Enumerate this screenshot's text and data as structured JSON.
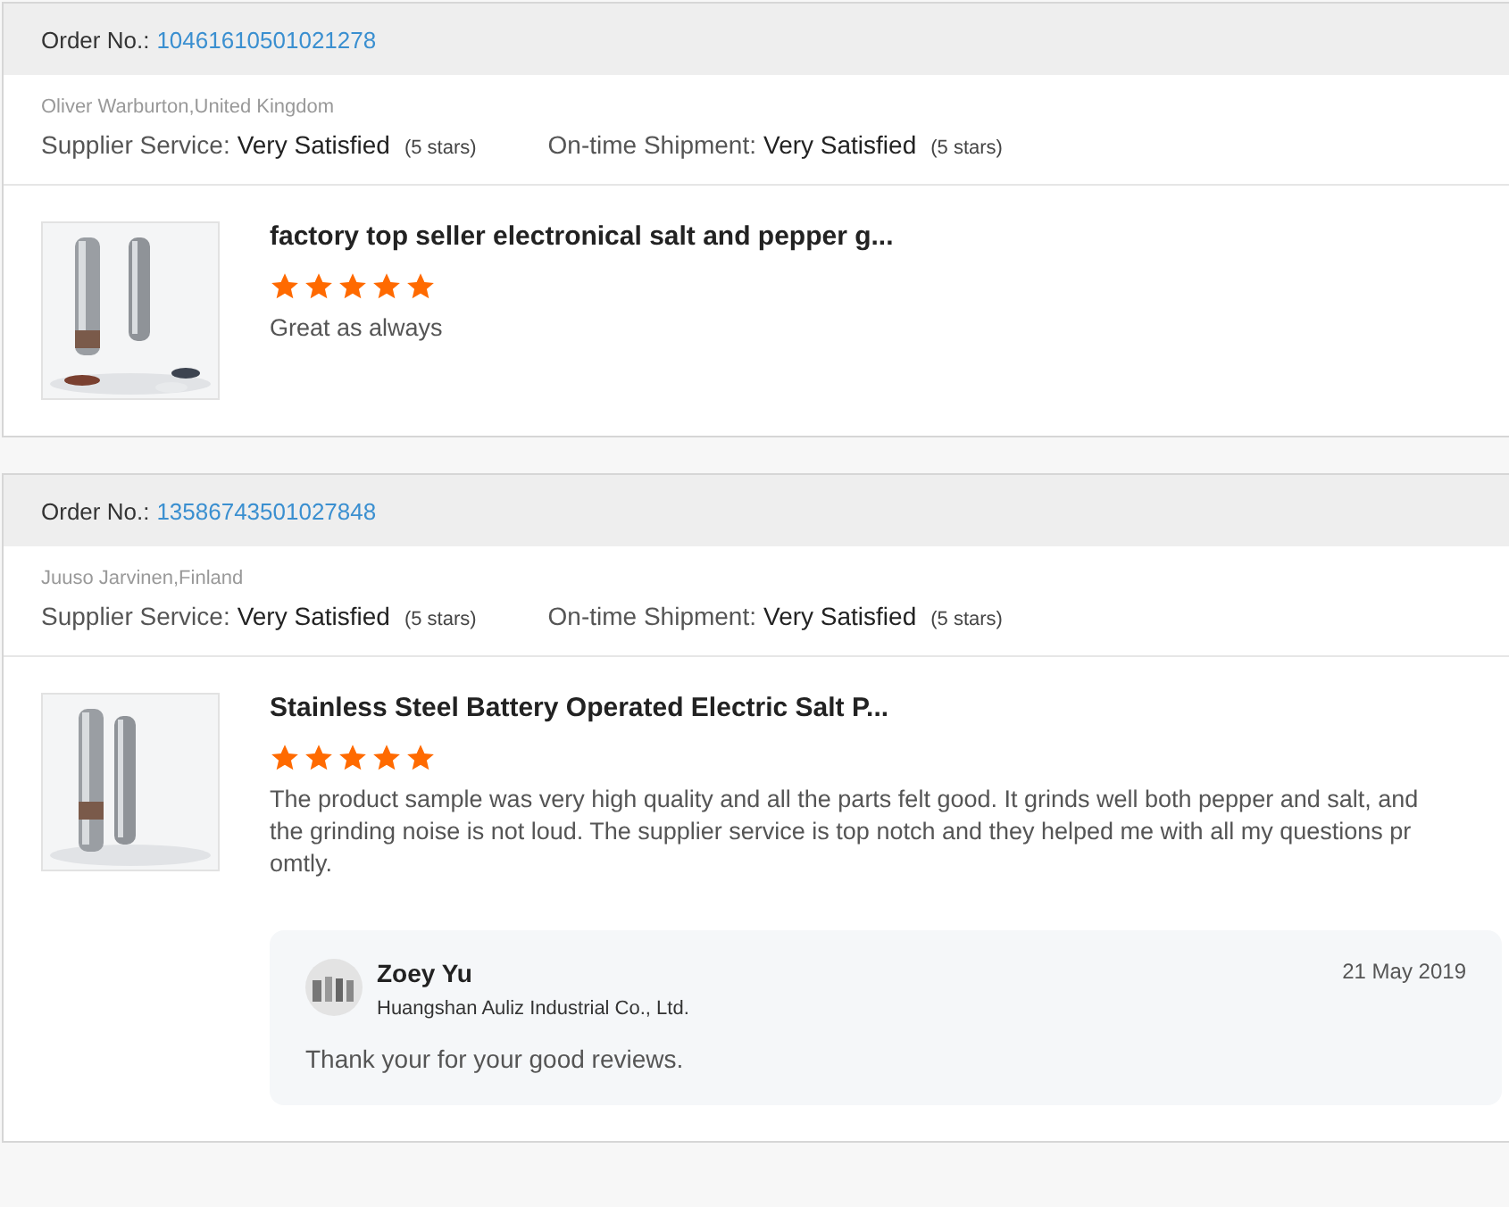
{
  "reviews": [
    {
      "order_label": "Order No.:",
      "order_number": "10461610501021278",
      "buyer": "Oliver Warburton,United Kingdom",
      "ratings": [
        {
          "label": "Supplier Service:",
          "value": "Very Satisfied",
          "note": "(5 stars)"
        },
        {
          "label": "On-time Shipment:",
          "value": "Very Satisfied",
          "note": "(5 stars)"
        }
      ],
      "product": {
        "title": "factory top seller electronical salt and pepper g...",
        "stars": 5,
        "comment": "Great as always"
      }
    },
    {
      "order_label": "Order No.:",
      "order_number": "13586743501027848",
      "buyer": "Juuso Jarvinen,Finland",
      "ratings": [
        {
          "label": "Supplier Service:",
          "value": "Very Satisfied",
          "note": "(5 stars)"
        },
        {
          "label": "On-time Shipment:",
          "value": "Very Satisfied",
          "note": "(5 stars)"
        }
      ],
      "product": {
        "title": "Stainless Steel Battery Operated Electric Salt P...",
        "stars": 5,
        "comment": "The product sample was very high quality and all the parts felt good. It grinds well both pepper and salt, and the grinding noise is not loud. The supplier service is top notch and they helped me with all my questions promtly."
      },
      "reply": {
        "name": "Zoey Yu",
        "company": "Huangshan Auliz Industrial Co., Ltd.",
        "date": "21 May 2019",
        "text": "Thank your for your good reviews."
      }
    }
  ]
}
